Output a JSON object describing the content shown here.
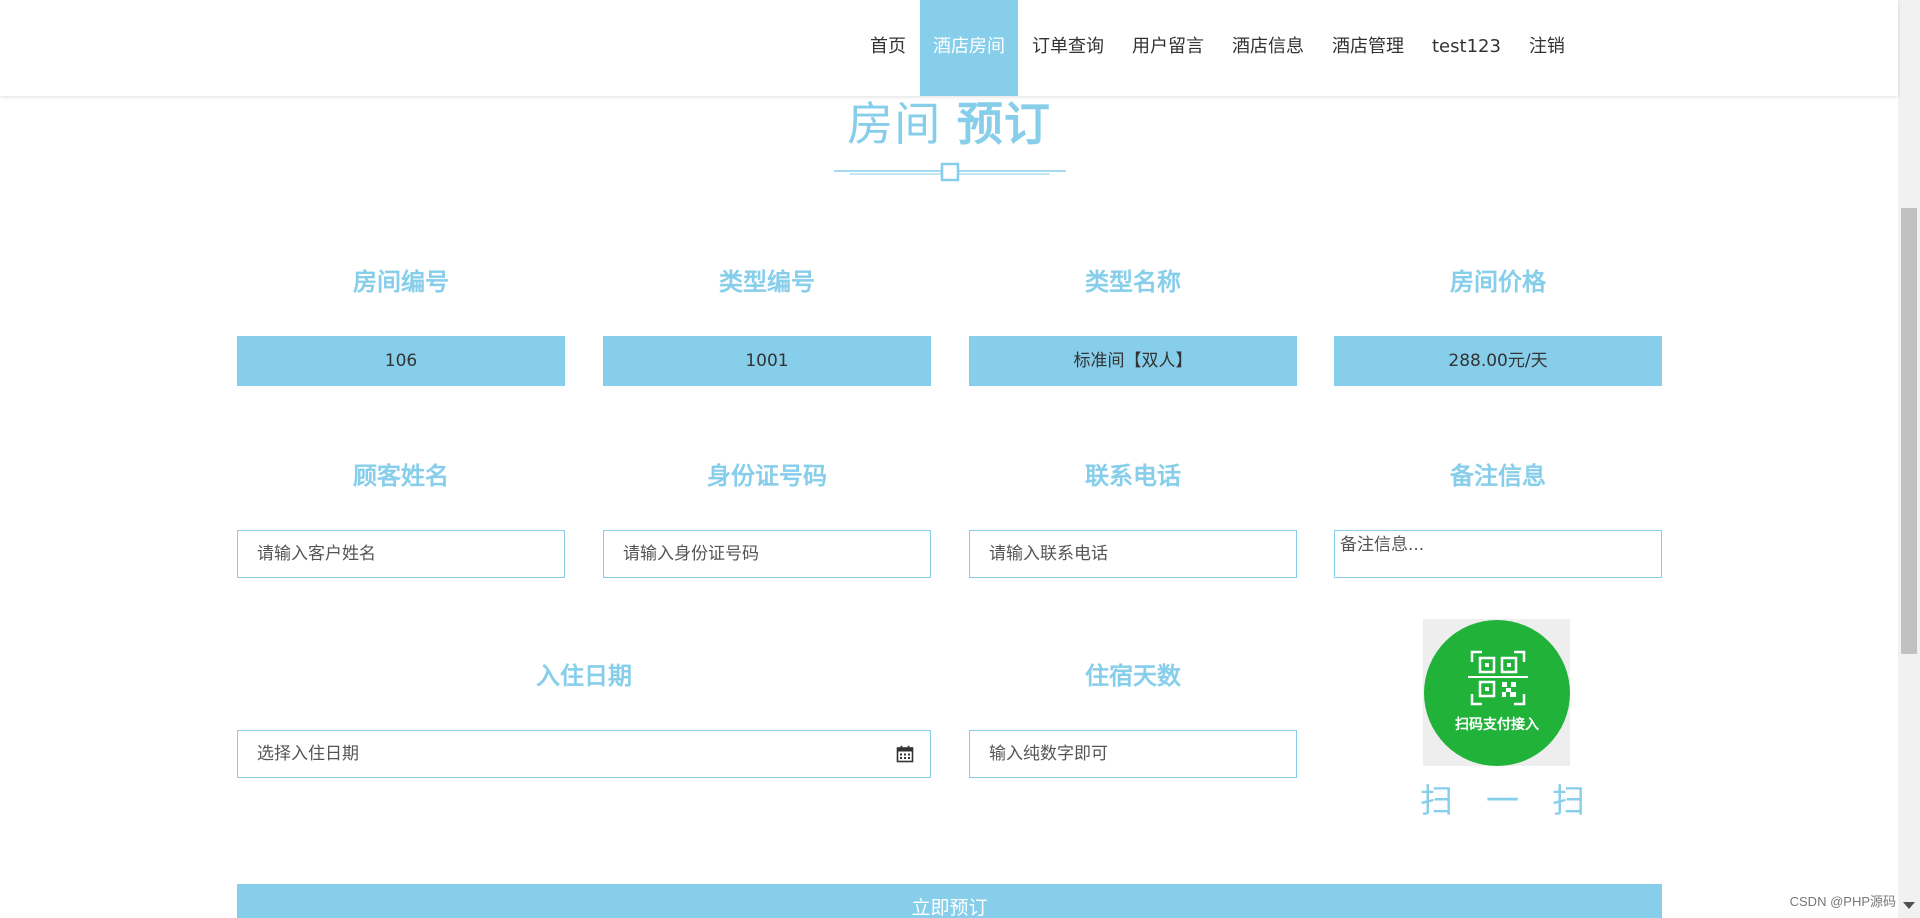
{
  "nav": {
    "items": [
      {
        "label": "首页",
        "active": false
      },
      {
        "label": "酒店房间",
        "active": true
      },
      {
        "label": "订单查询",
        "active": false
      },
      {
        "label": "用户留言",
        "active": false
      },
      {
        "label": "酒店信息",
        "active": false
      },
      {
        "label": "酒店管理",
        "active": false
      },
      {
        "label": "test123",
        "active": false
      },
      {
        "label": "注销",
        "active": false
      }
    ]
  },
  "title": {
    "light": "房间",
    "bold": "预订"
  },
  "room": {
    "number_label": "房间编号",
    "number_value": "106",
    "type_id_label": "类型编号",
    "type_id_value": "1001",
    "type_name_label": "类型名称",
    "type_name_value": "标准间【双人】",
    "price_label": "房间价格",
    "price_value": "288.00元/天"
  },
  "customer": {
    "name_label": "顾客姓名",
    "name_placeholder": "请输入客户姓名",
    "id_label": "身份证号码",
    "id_placeholder": "请输入身份证号码",
    "phone_label": "联系电话",
    "phone_placeholder": "请输入联系电话",
    "note_label": "备注信息",
    "note_placeholder": "备注信息..."
  },
  "stay": {
    "date_label": "入住日期",
    "date_placeholder": "选择入住日期",
    "days_label": "住宿天数",
    "days_placeholder": "输入纯数字即可"
  },
  "qr": {
    "caption": "扫码支付接入",
    "scan_text": "扫一扫"
  },
  "submit_label": "立即预订",
  "watermark": "CSDN @PHP源码",
  "colors": {
    "accent": "#87ceeb",
    "qr_green": "#21b23a"
  }
}
